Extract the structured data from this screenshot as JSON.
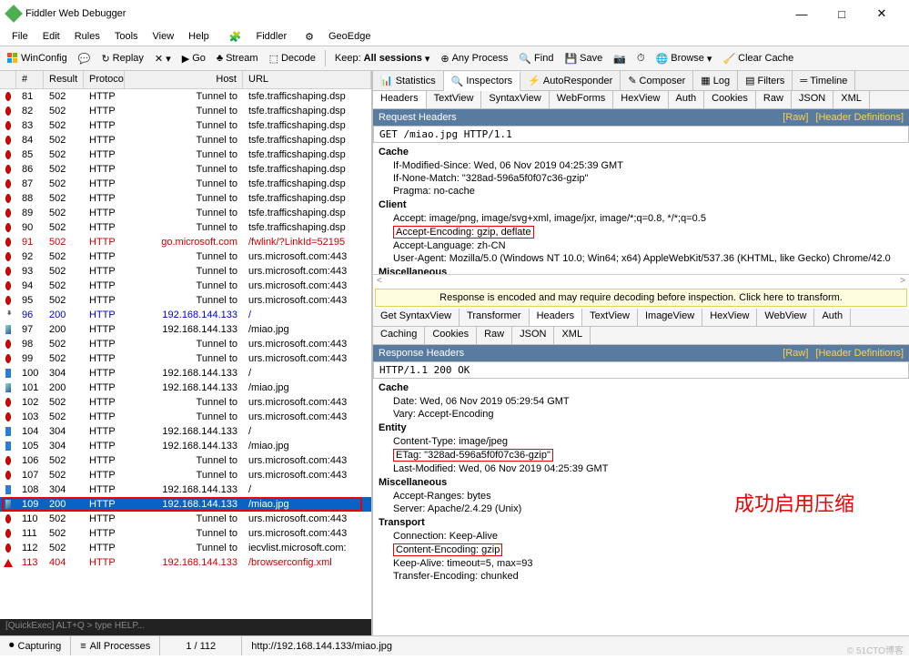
{
  "title": "Fiddler Web Debugger",
  "menu": [
    "File",
    "Edit",
    "Rules",
    "Tools",
    "View",
    "Help"
  ],
  "menu_extra": [
    "Fiddler",
    "GeoEdge"
  ],
  "toolbar_left": {
    "winconfig": "WinConfig",
    "replay": "Replay",
    "go": "Go",
    "stream": "Stream",
    "decode": "Decode"
  },
  "toolbar_right": {
    "keep_label": "Keep:",
    "keep_value": "All sessions",
    "any_process": "Any Process",
    "find": "Find",
    "save": "Save",
    "browse": "Browse",
    "clear_cache": "Clear Cache"
  },
  "grid_headers": {
    "num": "#",
    "result": "Result",
    "protocol": "Protocol",
    "host": "Host",
    "url": "URL"
  },
  "sessions": [
    {
      "icon": "red",
      "num": "81",
      "result": "502",
      "proto": "HTTP",
      "host": "Tunnel to",
      "url": "tsfe.trafficshaping.dsp"
    },
    {
      "icon": "red",
      "num": "82",
      "result": "502",
      "proto": "HTTP",
      "host": "Tunnel to",
      "url": "tsfe.trafficshaping.dsp"
    },
    {
      "icon": "red",
      "num": "83",
      "result": "502",
      "proto": "HTTP",
      "host": "Tunnel to",
      "url": "tsfe.trafficshaping.dsp"
    },
    {
      "icon": "red",
      "num": "84",
      "result": "502",
      "proto": "HTTP",
      "host": "Tunnel to",
      "url": "tsfe.trafficshaping.dsp"
    },
    {
      "icon": "red",
      "num": "85",
      "result": "502",
      "proto": "HTTP",
      "host": "Tunnel to",
      "url": "tsfe.trafficshaping.dsp"
    },
    {
      "icon": "red",
      "num": "86",
      "result": "502",
      "proto": "HTTP",
      "host": "Tunnel to",
      "url": "tsfe.trafficshaping.dsp"
    },
    {
      "icon": "red",
      "num": "87",
      "result": "502",
      "proto": "HTTP",
      "host": "Tunnel to",
      "url": "tsfe.trafficshaping.dsp"
    },
    {
      "icon": "red",
      "num": "88",
      "result": "502",
      "proto": "HTTP",
      "host": "Tunnel to",
      "url": "tsfe.trafficshaping.dsp"
    },
    {
      "icon": "red",
      "num": "89",
      "result": "502",
      "proto": "HTTP",
      "host": "Tunnel to",
      "url": "tsfe.trafficshaping.dsp"
    },
    {
      "icon": "red",
      "num": "90",
      "result": "502",
      "proto": "HTTP",
      "host": "Tunnel to",
      "url": "tsfe.trafficshaping.dsp"
    },
    {
      "icon": "red",
      "num": "91",
      "result": "502",
      "proto": "HTTP",
      "host": "go.microsoft.com",
      "url": "/fwlink/?LinkId=52195",
      "cls": "red-text"
    },
    {
      "icon": "red",
      "num": "92",
      "result": "502",
      "proto": "HTTP",
      "host": "Tunnel to",
      "url": "urs.microsoft.com:443"
    },
    {
      "icon": "red",
      "num": "93",
      "result": "502",
      "proto": "HTTP",
      "host": "Tunnel to",
      "url": "urs.microsoft.com:443"
    },
    {
      "icon": "red",
      "num": "94",
      "result": "502",
      "proto": "HTTP",
      "host": "Tunnel to",
      "url": "urs.microsoft.com:443"
    },
    {
      "icon": "red",
      "num": "95",
      "result": "502",
      "proto": "HTTP",
      "host": "Tunnel to",
      "url": "urs.microsoft.com:443"
    },
    {
      "icon": "arrow",
      "num": "96",
      "result": "200",
      "proto": "HTTP",
      "host": "192.168.144.133",
      "url": "/",
      "cls": "blue-text"
    },
    {
      "icon": "img",
      "num": "97",
      "result": "200",
      "proto": "HTTP",
      "host": "192.168.144.133",
      "url": "/miao.jpg"
    },
    {
      "icon": "red",
      "num": "98",
      "result": "502",
      "proto": "HTTP",
      "host": "Tunnel to",
      "url": "urs.microsoft.com:443"
    },
    {
      "icon": "red",
      "num": "99",
      "result": "502",
      "proto": "HTTP",
      "host": "Tunnel to",
      "url": "urs.microsoft.com:443"
    },
    {
      "icon": "blue",
      "num": "100",
      "result": "304",
      "proto": "HTTP",
      "host": "192.168.144.133",
      "url": "/"
    },
    {
      "icon": "img",
      "num": "101",
      "result": "200",
      "proto": "HTTP",
      "host": "192.168.144.133",
      "url": "/miao.jpg"
    },
    {
      "icon": "red",
      "num": "102",
      "result": "502",
      "proto": "HTTP",
      "host": "Tunnel to",
      "url": "urs.microsoft.com:443"
    },
    {
      "icon": "red",
      "num": "103",
      "result": "502",
      "proto": "HTTP",
      "host": "Tunnel to",
      "url": "urs.microsoft.com:443"
    },
    {
      "icon": "blue",
      "num": "104",
      "result": "304",
      "proto": "HTTP",
      "host": "192.168.144.133",
      "url": "/"
    },
    {
      "icon": "blue",
      "num": "105",
      "result": "304",
      "proto": "HTTP",
      "host": "192.168.144.133",
      "url": "/miao.jpg"
    },
    {
      "icon": "red",
      "num": "106",
      "result": "502",
      "proto": "HTTP",
      "host": "Tunnel to",
      "url": "urs.microsoft.com:443"
    },
    {
      "icon": "red",
      "num": "107",
      "result": "502",
      "proto": "HTTP",
      "host": "Tunnel to",
      "url": "urs.microsoft.com:443"
    },
    {
      "icon": "blue",
      "num": "108",
      "result": "304",
      "proto": "HTTP",
      "host": "192.168.144.133",
      "url": "/"
    },
    {
      "icon": "img",
      "num": "109",
      "result": "200",
      "proto": "HTTP",
      "host": "192.168.144.133",
      "url": "/miao.jpg",
      "cls": "selected"
    },
    {
      "icon": "red",
      "num": "110",
      "result": "502",
      "proto": "HTTP",
      "host": "Tunnel to",
      "url": "urs.microsoft.com:443"
    },
    {
      "icon": "red",
      "num": "111",
      "result": "502",
      "proto": "HTTP",
      "host": "Tunnel to",
      "url": "urs.microsoft.com:443"
    },
    {
      "icon": "red",
      "num": "112",
      "result": "502",
      "proto": "HTTP",
      "host": "Tunnel to",
      "url": "iecvlist.microsoft.com:"
    },
    {
      "icon": "warn",
      "num": "113",
      "result": "404",
      "proto": "HTTP",
      "host": "192.168.144.133",
      "url": "/browserconfig.xml",
      "cls": "red-text"
    }
  ],
  "quickexec": "[QuickExec] ALT+Q > type HELP...",
  "statusbar": {
    "capturing": "Capturing",
    "processes": "All Processes",
    "count": "1 / 112",
    "url": "http://192.168.144.133/miao.jpg"
  },
  "top_tabs": [
    "Statistics",
    "Inspectors",
    "AutoResponder",
    "Composer",
    "Log",
    "Filters",
    "Timeline"
  ],
  "top_tabs_active": 1,
  "req_tabs": [
    "Headers",
    "TextView",
    "SyntaxView",
    "WebForms",
    "HexView",
    "Auth",
    "Cookies",
    "Raw",
    "JSON",
    "XML"
  ],
  "req_tabs_active": 0,
  "req_header_title": "Request Headers",
  "raw_link": "[Raw]",
  "hdef_link": "[Header Definitions]",
  "req_line": "GET /miao.jpg HTTP/1.1",
  "req_tree": [
    {
      "hdr": "Cache",
      "items": [
        "If-Modified-Since: Wed, 06 Nov 2019 04:25:39 GMT",
        "If-None-Match: \"328ad-596a5f0f07c36-gzip\"",
        "Pragma: no-cache"
      ]
    },
    {
      "hdr": "Client",
      "items": [
        "Accept: image/png, image/svg+xml, image/jxr, image/*;q=0.8, */*;q=0.5",
        "Accept-Encoding: gzip, deflate",
        "Accept-Language: zh-CN",
        "User-Agent: Mozilla/5.0 (Windows NT 10.0; Win64; x64) AppleWebKit/537.36 (KHTML, like Gecko) Chrome/42.0"
      ]
    },
    {
      "hdr": "Miscellaneous",
      "items": []
    }
  ],
  "req_highlight_index": "1.1",
  "warn_text": "Response is encoded and may require decoding before inspection. Click here to transform.",
  "resp_tabs_top": [
    "Get SyntaxView",
    "Transformer",
    "Headers",
    "TextView",
    "ImageView",
    "HexView",
    "WebView",
    "Auth"
  ],
  "resp_tabs_top_active": 2,
  "resp_tabs_bot": [
    "Caching",
    "Cookies",
    "Raw",
    "JSON",
    "XML"
  ],
  "resp_header_title": "Response Headers",
  "resp_line": "HTTP/1.1 200 OK",
  "resp_tree": [
    {
      "hdr": "Cache",
      "items": [
        "Date: Wed, 06 Nov 2019 05:29:54 GMT",
        "Vary: Accept-Encoding"
      ]
    },
    {
      "hdr": "Entity",
      "items": [
        "Content-Type: image/jpeg",
        "ETag: \"328ad-596a5f0f07c36-gzip\"",
        "Last-Modified: Wed, 06 Nov 2019 04:25:39 GMT"
      ]
    },
    {
      "hdr": "Miscellaneous",
      "items": [
        "Accept-Ranges: bytes",
        "Server: Apache/2.4.29 (Unix)"
      ]
    },
    {
      "hdr": "Transport",
      "items": [
        "Connection: Keep-Alive",
        "Content-Encoding: gzip",
        "Keep-Alive: timeout=5, max=93",
        "Transfer-Encoding: chunked"
      ]
    }
  ],
  "annotation": "成功启用压缩",
  "watermark": "© 51CTO博客"
}
